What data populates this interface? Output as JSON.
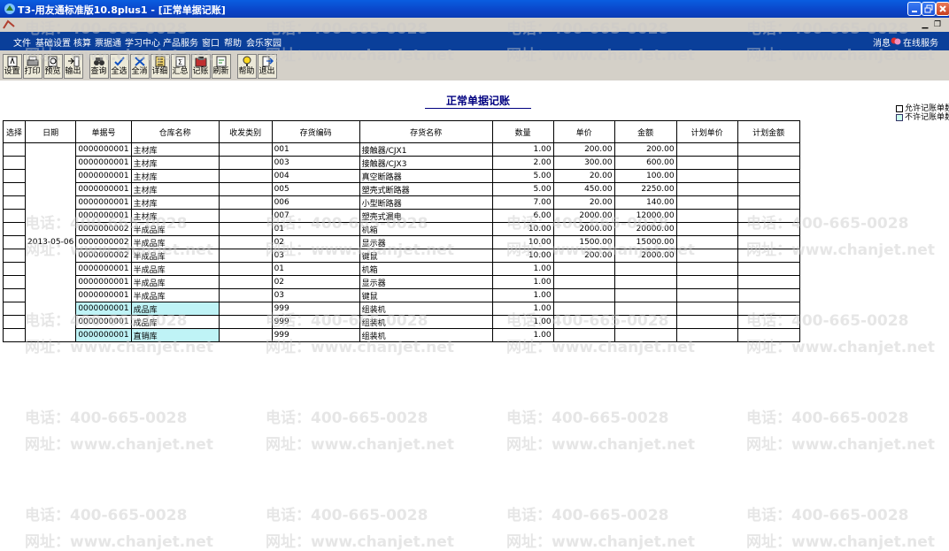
{
  "window": {
    "title": "T3-用友通标准版10.8plus1 - [正常单据记账]"
  },
  "menu": {
    "items": [
      "文件",
      "基础设置",
      "核算",
      "票据通",
      "学习中心",
      "产品服务",
      "窗口",
      "帮助",
      "会乐家园"
    ],
    "messages": "消息",
    "online_service": "在线服务"
  },
  "toolbar": {
    "buttons": [
      {
        "label": "设置",
        "icon": "setup-icon"
      },
      {
        "label": "打印",
        "icon": "print-icon"
      },
      {
        "label": "预览",
        "icon": "preview-icon"
      },
      {
        "label": "输出",
        "icon": "export-icon"
      },
      {
        "label": "查询",
        "icon": "binoculars-icon"
      },
      {
        "label": "全选",
        "icon": "select-all-icon"
      },
      {
        "label": "全消",
        "icon": "deselect-all-icon"
      },
      {
        "label": "详细",
        "icon": "detail-icon"
      },
      {
        "label": "汇总",
        "icon": "summary-icon"
      },
      {
        "label": "记账",
        "icon": "post-icon"
      },
      {
        "label": "刷新",
        "icon": "refresh-icon"
      },
      {
        "label": "帮助",
        "icon": "help-icon"
      },
      {
        "label": "退出",
        "icon": "exit-icon"
      }
    ]
  },
  "page": {
    "title": "正常单据记账",
    "allow_option": "允许记账单数",
    "disallow_option": "不许记账单数"
  },
  "table": {
    "headers": [
      "选择",
      "日期",
      "单据号",
      "仓库名称",
      "收发类别",
      "存货编码",
      "存货名称",
      "数量",
      "单价",
      "金额",
      "计划单价",
      "计划金额"
    ],
    "date": "2013-05-06",
    "rows": [
      {
        "doc": "0000000001",
        "wh": "主材库",
        "code": "001",
        "name": "接触器/CJX1",
        "qty": "1.00",
        "price": "200.00",
        "amount": "200.00",
        "hl": false
      },
      {
        "doc": "0000000001",
        "wh": "主材库",
        "code": "003",
        "name": "接触器/CJX3",
        "qty": "2.00",
        "price": "300.00",
        "amount": "600.00",
        "hl": false
      },
      {
        "doc": "0000000001",
        "wh": "主材库",
        "code": "004",
        "name": "真空断路器",
        "qty": "5.00",
        "price": "20.00",
        "amount": "100.00",
        "hl": false
      },
      {
        "doc": "0000000001",
        "wh": "主材库",
        "code": "005",
        "name": "塑壳式断路器",
        "qty": "5.00",
        "price": "450.00",
        "amount": "2250.00",
        "hl": false
      },
      {
        "doc": "0000000001",
        "wh": "主材库",
        "code": "006",
        "name": "小型断路器",
        "qty": "7.00",
        "price": "20.00",
        "amount": "140.00",
        "hl": false
      },
      {
        "doc": "0000000001",
        "wh": "主材库",
        "code": "007",
        "name": "塑壳式漏电",
        "qty": "6.00",
        "price": "2000.00",
        "amount": "12000.00",
        "hl": false
      },
      {
        "doc": "0000000002",
        "wh": "半成品库",
        "code": "01",
        "name": "机箱",
        "qty": "10.00",
        "price": "2000.00",
        "amount": "20000.00",
        "hl": false
      },
      {
        "doc": "0000000002",
        "wh": "半成品库",
        "code": "02",
        "name": "显示器",
        "qty": "10.00",
        "price": "1500.00",
        "amount": "15000.00",
        "hl": false
      },
      {
        "doc": "0000000002",
        "wh": "半成品库",
        "code": "03",
        "name": "键鼠",
        "qty": "10.00",
        "price": "200.00",
        "amount": "2000.00",
        "hl": false
      },
      {
        "doc": "0000000001",
        "wh": "半成品库",
        "code": "01",
        "name": "机箱",
        "qty": "1.00",
        "price": "",
        "amount": "",
        "hl": false
      },
      {
        "doc": "0000000001",
        "wh": "半成品库",
        "code": "02",
        "name": "显示器",
        "qty": "1.00",
        "price": "",
        "amount": "",
        "hl": false
      },
      {
        "doc": "0000000001",
        "wh": "半成品库",
        "code": "03",
        "name": "键鼠",
        "qty": "1.00",
        "price": "",
        "amount": "",
        "hl": false
      },
      {
        "doc": "0000000001",
        "wh": "成品库",
        "code": "999",
        "name": "组装机",
        "qty": "1.00",
        "price": "",
        "amount": "",
        "hl": true
      },
      {
        "doc": "0000000001",
        "wh": "成品库",
        "code": "999",
        "name": "组装机",
        "qty": "1.00",
        "price": "",
        "amount": "",
        "hl": false
      },
      {
        "doc": "0000000001",
        "wh": "直销库",
        "code": "999",
        "name": "组装机",
        "qty": "1.00",
        "price": "",
        "amount": "",
        "hl": true
      }
    ]
  },
  "watermark": {
    "phone": "电话：400-665-0028",
    "site": "网址：www.chanjet.net"
  }
}
